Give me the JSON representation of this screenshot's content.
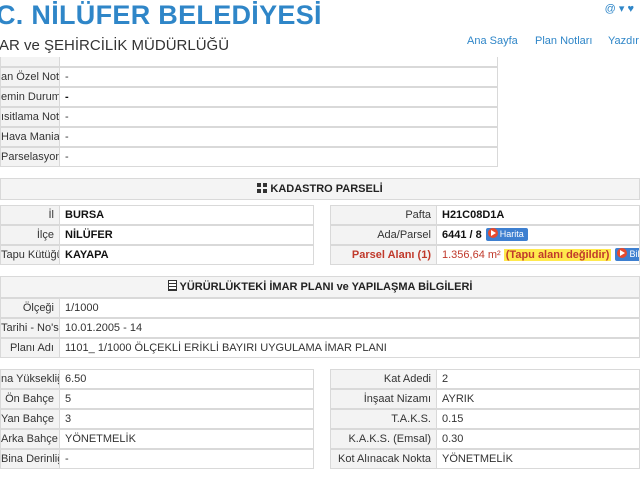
{
  "header": {
    "title": "C. NİLÜFER BELEDİYESİ",
    "subtitle": "AR ve ŞEHİRCİLİK MÜDÜRLÜĞÜ",
    "nav": [
      "Ana Sayfa",
      "Plan Notları",
      "Yazdır"
    ],
    "top_icons": "@ ▾ ♥"
  },
  "top_rows": [
    {
      "label": "an Özel Notu",
      "value": "-"
    },
    {
      "label": "emin Durumu",
      "value": "-"
    },
    {
      "label": "ısitlama Notu",
      "value": "-"
    },
    {
      "label": "Hava Mania",
      "value": "-"
    },
    {
      "label": "Parselasyon",
      "value": "-"
    }
  ],
  "kadastro": {
    "heading": "KADASTRO PARSELİ",
    "left": [
      {
        "label": "İl",
        "value": "BURSA"
      },
      {
        "label": "İlçe",
        "value": "NİLÜFER"
      },
      {
        "label": "Tapu Kütüğü",
        "value": "KAYAPA"
      }
    ],
    "right": {
      "pafta_label": "Pafta",
      "pafta_value": "H21C08D1A",
      "ada_label": "Ada/Parsel",
      "ada_value": "6441 / 8",
      "harita_label": "Harita",
      "alan_label": "Parsel Alanı",
      "alan_sup": "(1)",
      "alan_value": "1.356,64 m²",
      "tapu_warning": "(Tapu alanı değildir)",
      "bilgi_label": "Bilgi"
    }
  },
  "imar": {
    "heading": "YÜRÜRLÜKTEKİ İMAR PLANI ve YAPILAŞMA BİLGİLERİ",
    "full": [
      {
        "label": "Ölçeği",
        "value": "1/1000"
      },
      {
        "label": "Tarihi - No'su",
        "value": "10.01.2005 - 14"
      },
      {
        "label": "Planı Adı",
        "value": "1101_ 1/1000 ÖLÇEKLİ ERİKLİ BAYIRI UYGULAMA İMAR PLANI"
      }
    ],
    "left": [
      {
        "label": "na Yüksekliği",
        "value": "6.50"
      },
      {
        "label": "Ön Bahçe",
        "value": "5"
      },
      {
        "label": "Yan Bahçe",
        "value": "3"
      },
      {
        "label": "Arka Bahçe",
        "value": "YÖNETMELİK"
      },
      {
        "label": "Bina Derinliği",
        "value": "-"
      }
    ],
    "right": [
      {
        "label": "Kat Adedi",
        "value": "2"
      },
      {
        "label": "İnşaat Nizamı",
        "value": "AYRIK"
      },
      {
        "label": "T.A.K.S.",
        "value": "0.15"
      },
      {
        "label": "K.A.K.S. (Emsal)",
        "value": "0.30"
      },
      {
        "label": "Kot Alınacak Nokta",
        "value": "YÖNETMELİK"
      }
    ]
  }
}
